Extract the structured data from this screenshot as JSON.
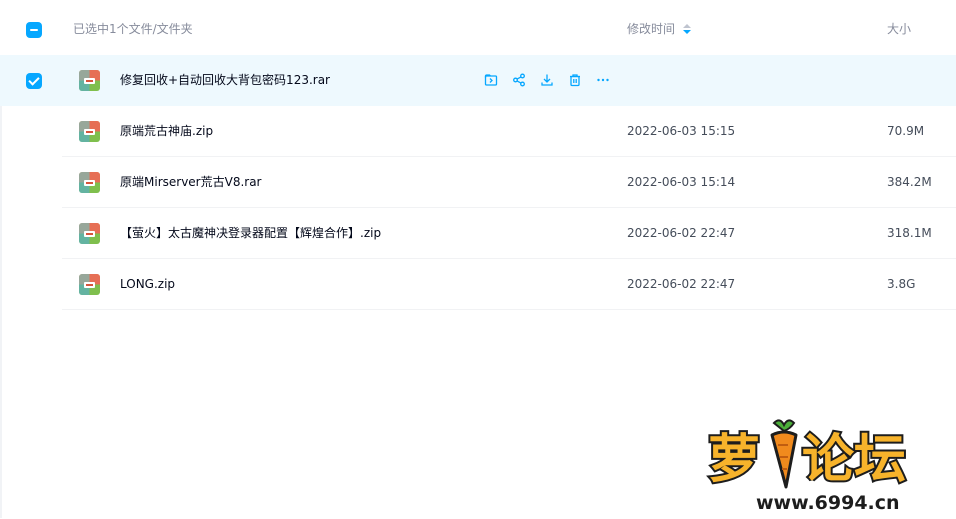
{
  "header": {
    "selection_label": "已选中1个文件/文件夹",
    "col_mtime": "修改时间",
    "col_size": "大小"
  },
  "files": [
    {
      "name": "修复回收+自动回收大背包密码123.rar",
      "time": "",
      "size": "",
      "selected": true,
      "actions": [
        "share-folder-icon",
        "share-icon",
        "download-icon",
        "delete-icon",
        "more-icon"
      ]
    },
    {
      "name": "原端荒古神庙.zip",
      "time": "2022-06-03 15:15",
      "size": "70.9M",
      "selected": false
    },
    {
      "name": "原端Mirserver荒古V8.rar",
      "time": "2022-06-03 15:14",
      "size": "384.2M",
      "selected": false
    },
    {
      "name": "【萤火】太古魔神决登录器配置【辉煌合作】.zip",
      "time": "2022-06-02 22:47",
      "size": "318.1M",
      "selected": false
    },
    {
      "name": "LONG.zip",
      "time": "2022-06-02 22:47",
      "size": "3.8G",
      "selected": false
    }
  ],
  "watermark": {
    "text": "萝卜论坛",
    "url": "www.6994.cn"
  },
  "colors": {
    "accent": "#06a7ff",
    "selected_row": "#eef9fe",
    "watermark_orange": "#f7b32b"
  }
}
